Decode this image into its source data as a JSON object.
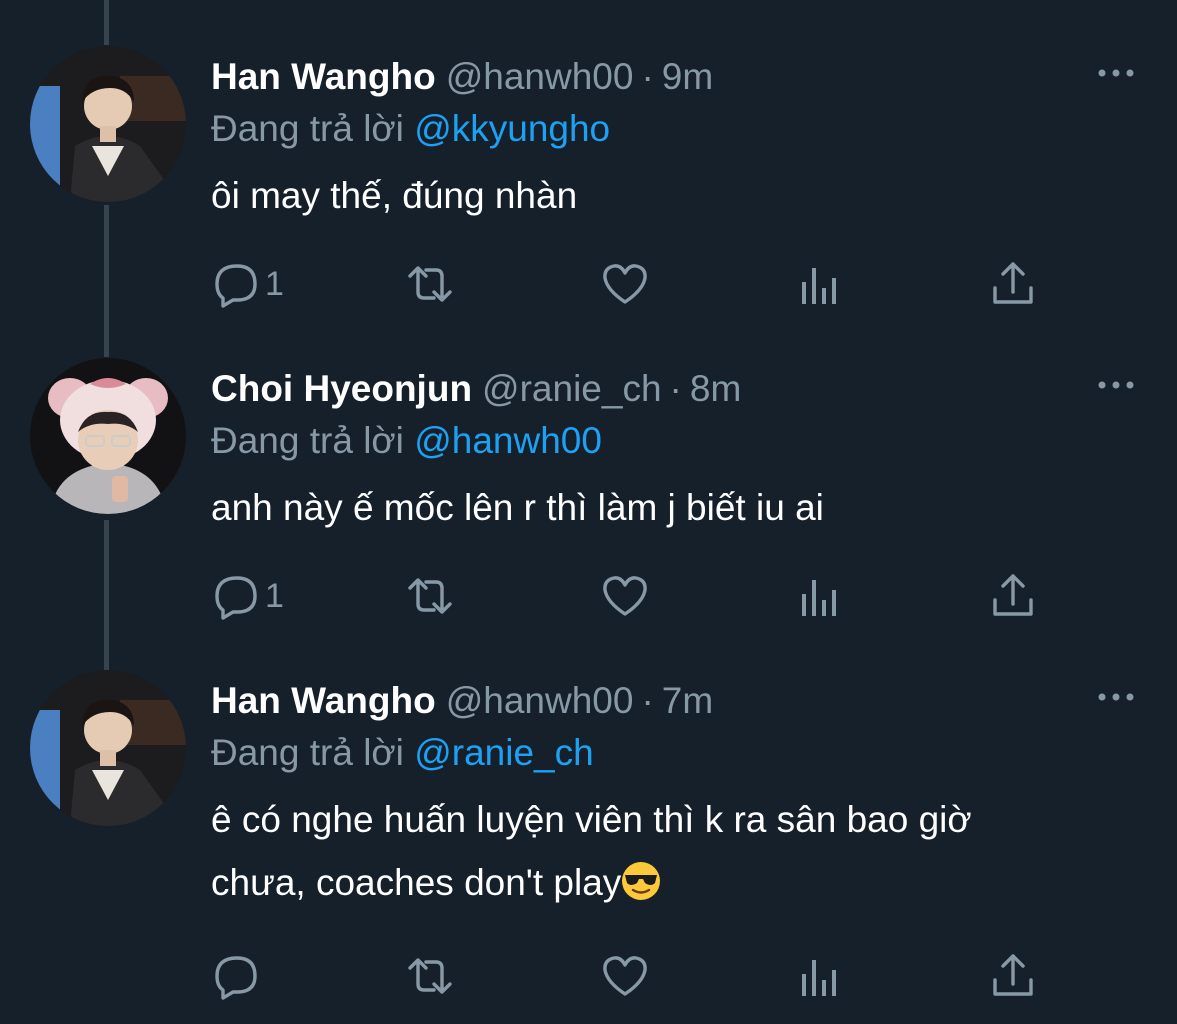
{
  "colors": {
    "background": "#15202b",
    "primary_text": "#ffffff",
    "secondary_text": "#8899a6",
    "link": "#1da1f2",
    "thread_line": "#38444d"
  },
  "tweets": [
    {
      "display_name": "Han Wangho",
      "handle": "@hanwh00",
      "dot": "·",
      "time": "9m",
      "replying_prefix": "Đang trả lời",
      "replying_to": "@kkyungho",
      "text": "ôi may thế, đúng nhàn",
      "reply_count": "1",
      "avatar_icon": "avatar-han-wangho"
    },
    {
      "display_name": "Choi Hyeonjun",
      "handle": "@ranie_ch",
      "dot": "·",
      "time": "8m",
      "replying_prefix": "Đang trả lời",
      "replying_to": "@hanwh00",
      "text": "anh này ế mốc lên r thì làm j biết iu ai",
      "reply_count": "1",
      "avatar_icon": "avatar-choi-hyeonjun"
    },
    {
      "display_name": "Han Wangho",
      "handle": "@hanwh00",
      "dot": "·",
      "time": "7m",
      "replying_prefix": "Đang trả lời",
      "replying_to": "@ranie_ch",
      "text_line1": "ê có nghe huấn luyện viên thì k ra sân bao giờ",
      "text_line2": "chưa, coaches don't play",
      "emoji": "smiling-face-with-sunglasses",
      "reply_count": "",
      "avatar_icon": "avatar-han-wangho"
    }
  ],
  "icons": {
    "reply": "reply-icon",
    "retweet": "retweet-icon",
    "like": "heart-icon",
    "analytics": "analytics-icon",
    "share": "share-icon",
    "more": "more-icon"
  }
}
